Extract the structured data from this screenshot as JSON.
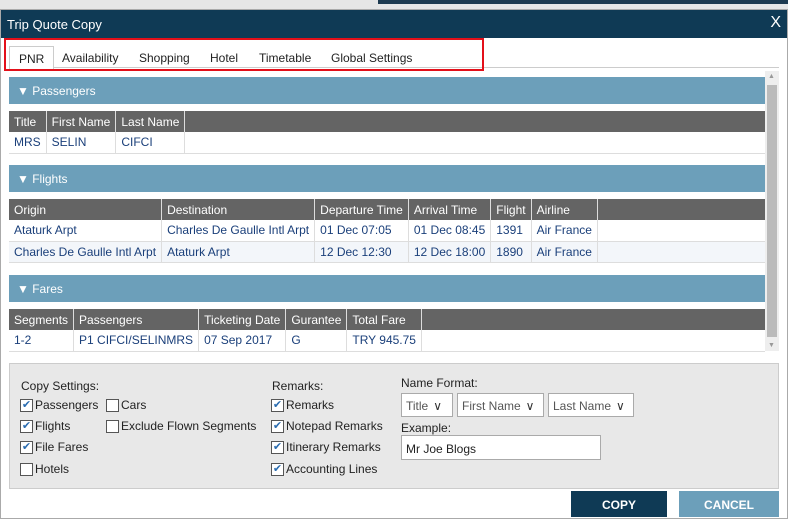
{
  "window": {
    "title": "Trip Quote Copy",
    "close": "X"
  },
  "tabs": [
    "PNR",
    "Availability",
    "Shopping",
    "Hotel",
    "Timetable",
    "Global Settings"
  ],
  "passengers": {
    "header": "▼ Passengers",
    "columns": [
      "Title",
      "First Name",
      "Last Name"
    ],
    "rows": [
      [
        "MRS",
        "SELIN",
        "CIFCI"
      ]
    ]
  },
  "flights": {
    "header": "▼ Flights",
    "columns": [
      "Origin",
      "Destination",
      "Departure Time",
      "Arrival Time",
      "Flight",
      "Airline"
    ],
    "rows": [
      [
        "Ataturk Arpt",
        "Charles De Gaulle Intl Arpt",
        "01 Dec 07:05",
        "01 Dec 08:45",
        "1391",
        "Air France"
      ],
      [
        "Charles De Gaulle Intl Arpt",
        "Ataturk Arpt",
        "12 Dec 12:30",
        "12 Dec 18:00",
        "1890",
        "Air France"
      ]
    ]
  },
  "fares": {
    "header": "▼ Fares",
    "columns": [
      "Segments",
      "Passengers",
      "Ticketing Date",
      "Gurantee",
      "Total Fare"
    ],
    "rows": [
      [
        "1-2",
        "P1 CIFCI/SELINMRS",
        "07 Sep 2017",
        "G",
        "TRY 945.75"
      ]
    ]
  },
  "settings": {
    "copy_label": "Copy Settings:",
    "copy": [
      {
        "label": "Passengers",
        "checked": true
      },
      {
        "label": "Flights",
        "checked": true
      },
      {
        "label": "File Fares",
        "checked": true
      },
      {
        "label": "Hotels",
        "checked": false
      },
      {
        "label": "Cars",
        "checked": false
      },
      {
        "label": "Exclude Flown Segments",
        "checked": false
      }
    ],
    "remarks_label": "Remarks:",
    "remarks": [
      {
        "label": "Remarks",
        "checked": true
      },
      {
        "label": "Notepad Remarks",
        "checked": true
      },
      {
        "label": "Itinerary Remarks",
        "checked": true
      },
      {
        "label": "Accounting Lines",
        "checked": true
      }
    ],
    "name_format_label": "Name Format:",
    "name_format": [
      "Title",
      "First Name",
      "Last Name"
    ],
    "example_label": "Example:",
    "example_value": "Mr Joe Blogs"
  },
  "buttons": {
    "copy": "COPY",
    "cancel": "CANCEL"
  },
  "colors": {
    "titlebar": "#0f3a55",
    "section": "#6c9fba",
    "copy_button": "#0f3a55",
    "cancel_button": "#6c9fba",
    "highlight": "#e3101a"
  }
}
